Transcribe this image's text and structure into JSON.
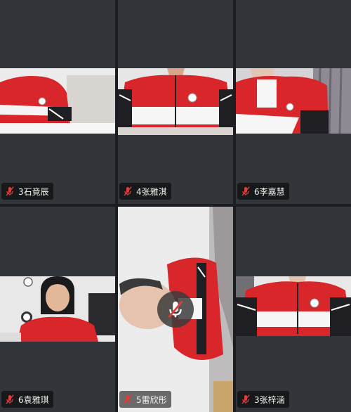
{
  "participants": [
    {
      "name": "3石竟辰",
      "muted": true
    },
    {
      "name": "4张雅淇",
      "muted": true
    },
    {
      "name": "6李嘉慧",
      "muted": true
    },
    {
      "name": "6袁雅琪",
      "muted": true
    },
    {
      "name": "5雷欣彤",
      "muted": true
    },
    {
      "name": "3张梓涵",
      "muted": true
    }
  ],
  "icons": {
    "tile_mic": "mic-muted-icon",
    "center_mic": "mic-muted-icon"
  },
  "colors": {
    "background": "#1b1d20",
    "tile": "#323539",
    "muted_red": "#e23b3b",
    "uniform_red": "#d8262b"
  }
}
